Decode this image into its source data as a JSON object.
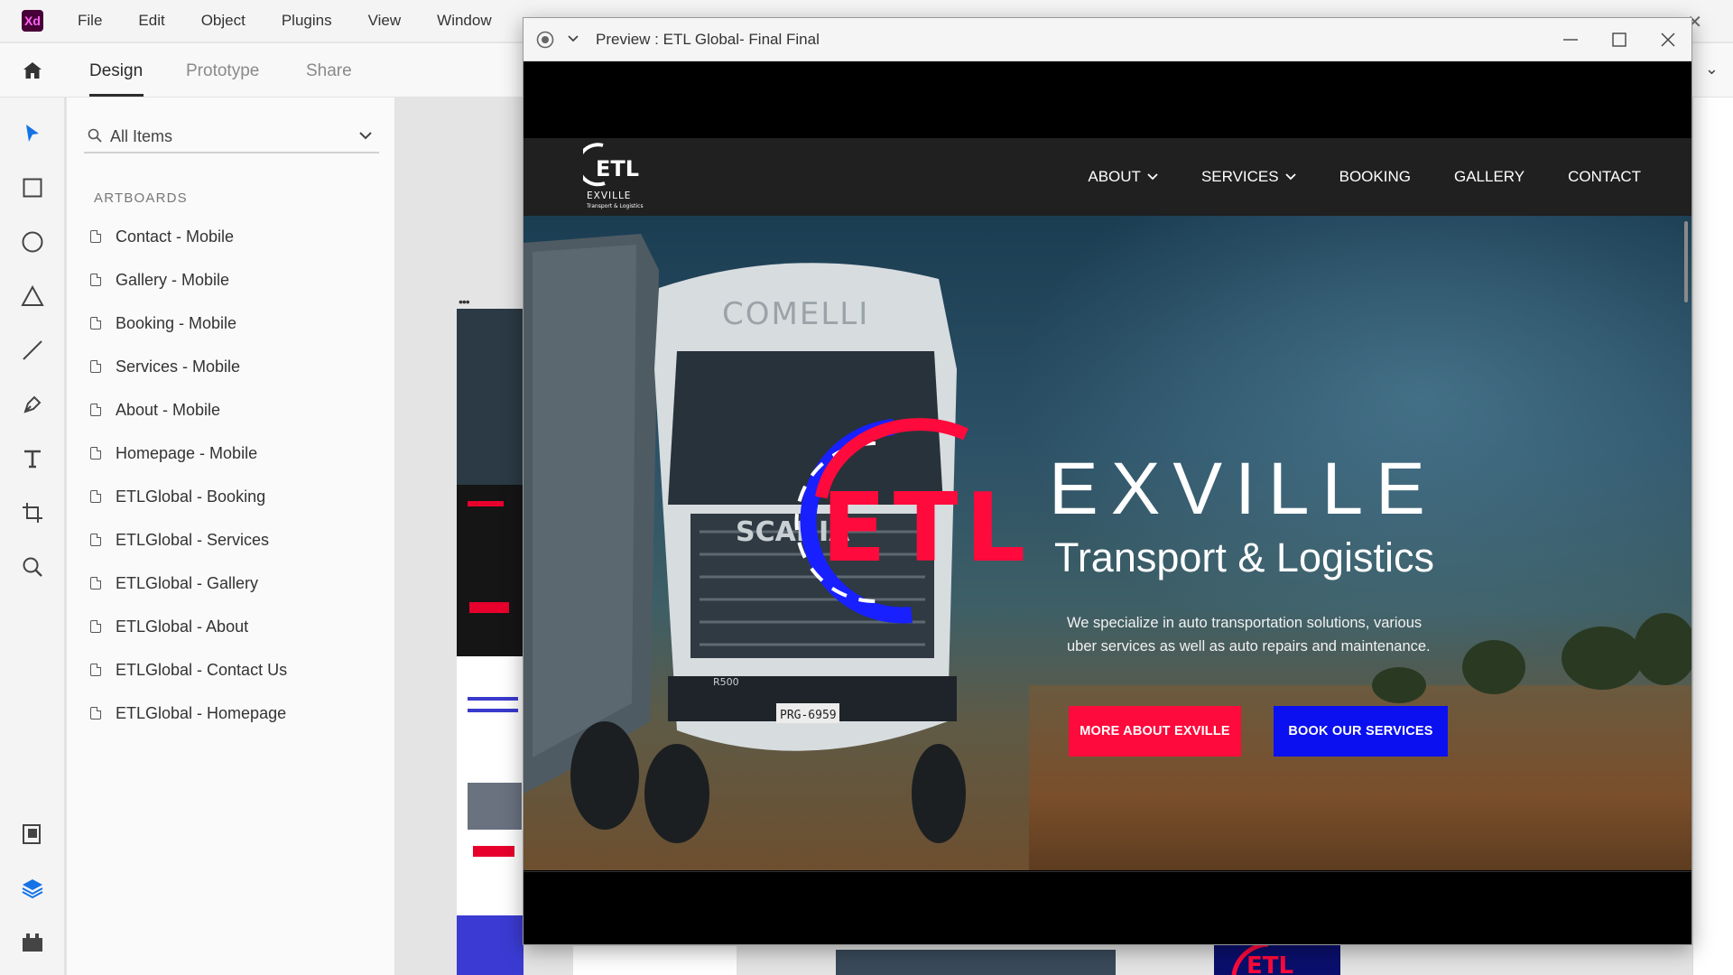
{
  "app": {
    "logo": "Xd",
    "menu": [
      "File",
      "Edit",
      "Object",
      "Plugins",
      "View",
      "Window"
    ],
    "tabs": [
      {
        "label": "Design",
        "active": true
      },
      {
        "label": "Prototype",
        "active": false
      },
      {
        "label": "Share",
        "active": false
      }
    ]
  },
  "layers": {
    "filter": "All Items",
    "section": "ARTBOARDS",
    "artboards": [
      "Contact - Mobile",
      "Gallery - Mobile",
      "Booking - Mobile",
      "Services - Mobile",
      "About - Mobile",
      "Homepage - Mobile",
      "ETLGlobal - Booking",
      "ETLGlobal - Services",
      "ETLGlobal - Gallery",
      "ETLGlobal - About",
      "ETLGlobal - Contact Us",
      "ETLGlobal - Homepage"
    ]
  },
  "preview": {
    "title": "Preview : ETL Global- Final Final"
  },
  "site": {
    "logo_text": "ETL",
    "logo_sub": "EXVILLE",
    "logo_sub2": "Transport & Logistics",
    "nav": [
      "ABOUT",
      "SERVICES",
      "BOOKING",
      "GALLERY",
      "CONTACT"
    ],
    "hero": {
      "logo_letters": "ETL",
      "brand": "EXVILLE",
      "tagline": "Transport & Logistics",
      "description": "We specialize in auto transportation solutions, various uber services as well as auto repairs and maintenance.",
      "btn_more": "MORE ABOUT EXVILLE",
      "btn_book": "BOOK OUR SERVICES",
      "truck_brand": "COMELLI",
      "truck_make": "SCANIA",
      "truck_plate": "PRG-6959",
      "truck_model": "R500"
    }
  },
  "colors": {
    "accent_red": "#ff0a3c",
    "accent_blue": "#0a10f0",
    "nav_bg": "#202020"
  }
}
